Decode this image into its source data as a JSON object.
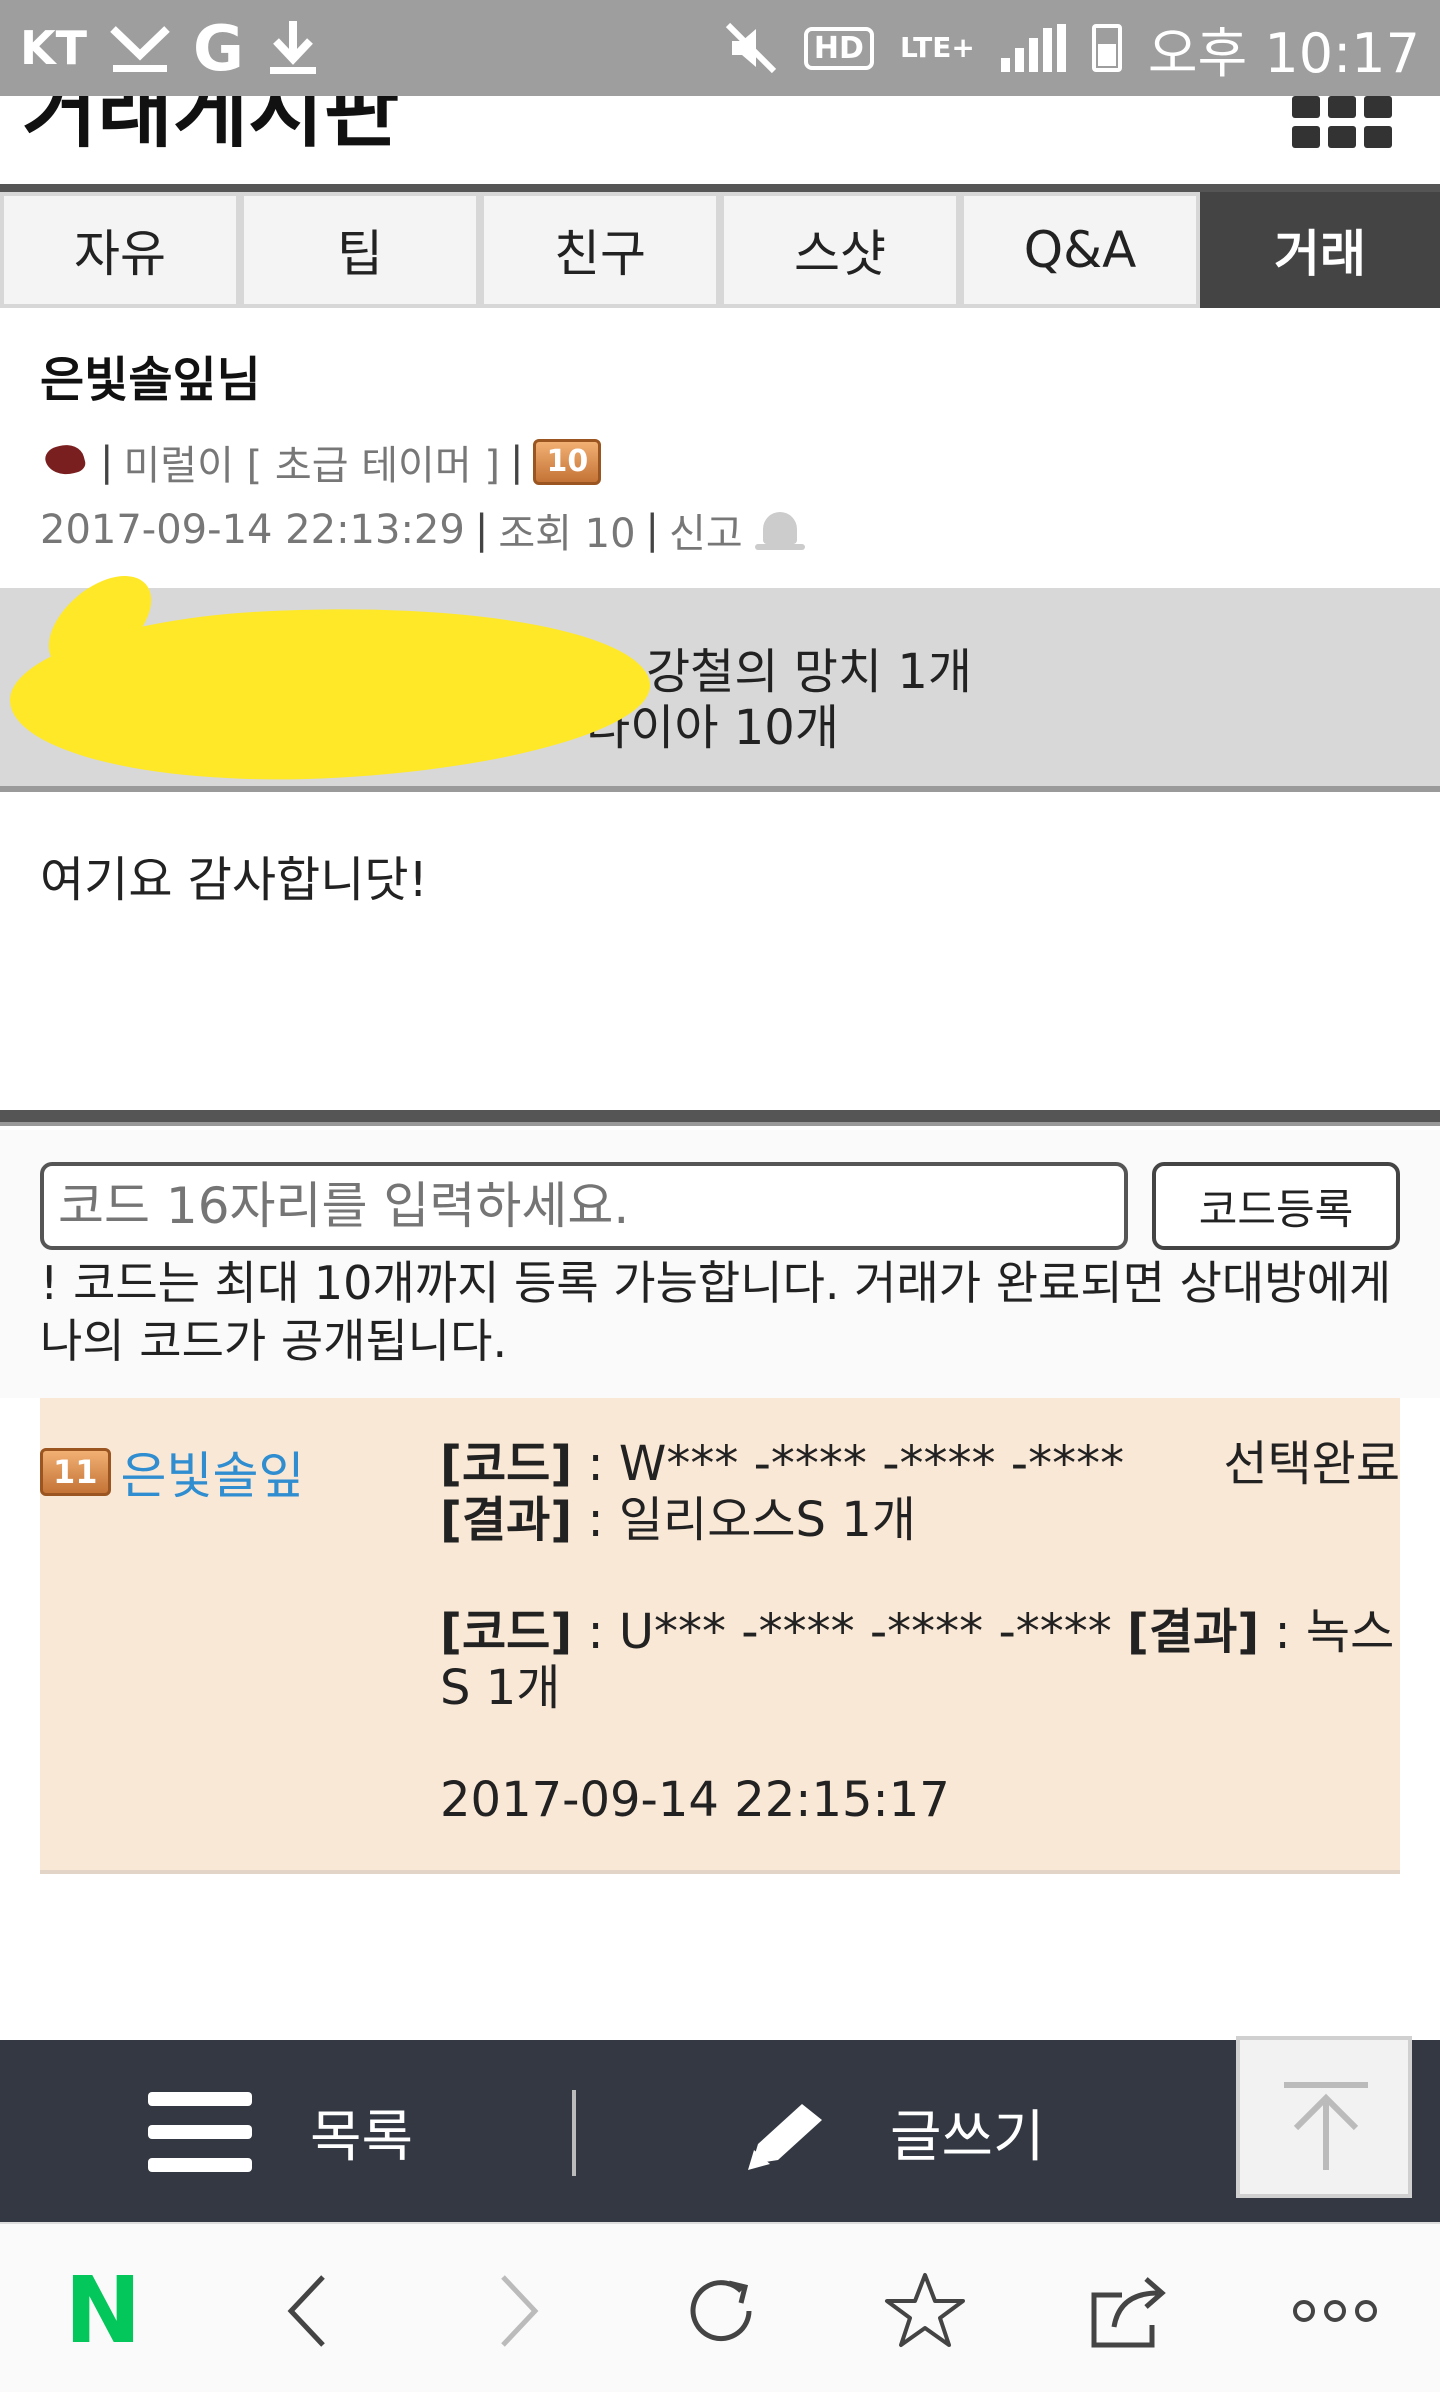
{
  "status_bar": {
    "carrier": "KT",
    "g_label": "G",
    "hd_label": "HD",
    "lte_label": "LTE+",
    "time": "오후 10:17"
  },
  "header": {
    "title": "거래게시판"
  },
  "tabs": [
    {
      "label": "자유",
      "active": false
    },
    {
      "label": "팁",
      "active": false
    },
    {
      "label": "친구",
      "active": false
    },
    {
      "label": "스샷",
      "active": false
    },
    {
      "label": "Q&A",
      "active": false
    },
    {
      "label": "거래",
      "active": true
    }
  ],
  "post": {
    "author": "은빛솔잎님",
    "rank": "미럴이 [ 초급 테이머 ]",
    "level": "10",
    "datetime": "2017-09-14 22:13:29",
    "views": "조회 10",
    "report": "신고",
    "trade_line1": "강철의 망치 1개",
    "trade_line2": "다이아 10개",
    "body": "여기요 감사합니닷!"
  },
  "code_entry": {
    "placeholder": "코드 16자리를 입력하세요.",
    "button": "코드등록",
    "notice": "! 코드는 최대 10개까지 등록 가능합니다. 거래가 완료되면 상대방에게 나의 코드가 공개됩니다."
  },
  "reply": {
    "level": "11",
    "name": "은빛솔잎",
    "code_label": "[코드]",
    "result_label": "[결과]",
    "code1": " : W*** -**** -**** -****",
    "status1": "선택완료",
    "result1": " : 일리오스S 1개",
    "code2": " : U*** -**** -**** -****",
    "result2": " : 녹스S 1개",
    "datetime": "2017-09-14 22:15:17"
  },
  "actions": {
    "list_label": "목록",
    "write_label": "글쓰기"
  },
  "browser": {
    "logo": "N",
    "brand_color": "#03c75a"
  }
}
